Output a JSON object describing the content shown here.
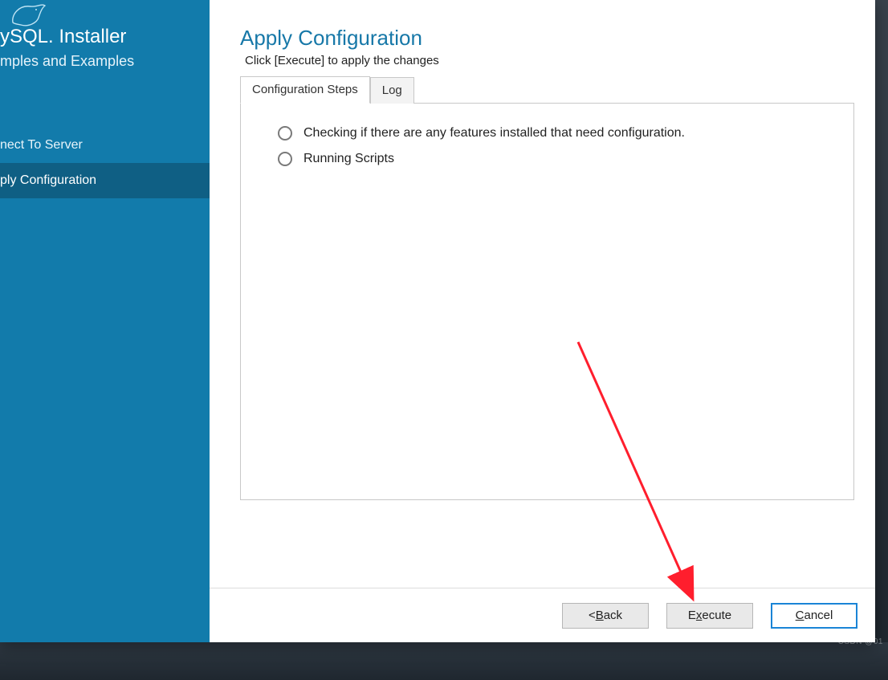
{
  "sidebar": {
    "brand_left": "ySQL",
    "brand_right": "Installer",
    "subtitle": "mples and Examples",
    "items": [
      {
        "label": "nect To Server"
      },
      {
        "label": "ply Configuration"
      }
    ],
    "active_index": 1
  },
  "main": {
    "title": "Apply Configuration",
    "description": "Click [Execute] to apply the changes",
    "tabs": [
      {
        "label": "Configuration Steps"
      },
      {
        "label": "Log"
      }
    ],
    "active_tab": 0,
    "steps": [
      {
        "label": "Checking if there are any features installed that need configuration."
      },
      {
        "label": "Running Scripts"
      }
    ]
  },
  "footer": {
    "back_prefix": "< ",
    "back_u": "B",
    "back_rest": "ack",
    "exec_pre": "E",
    "exec_u": "x",
    "exec_rest": "ecute",
    "cancel_u": "C",
    "cancel_rest": "ancel"
  },
  "watermark": "CSDN @01"
}
